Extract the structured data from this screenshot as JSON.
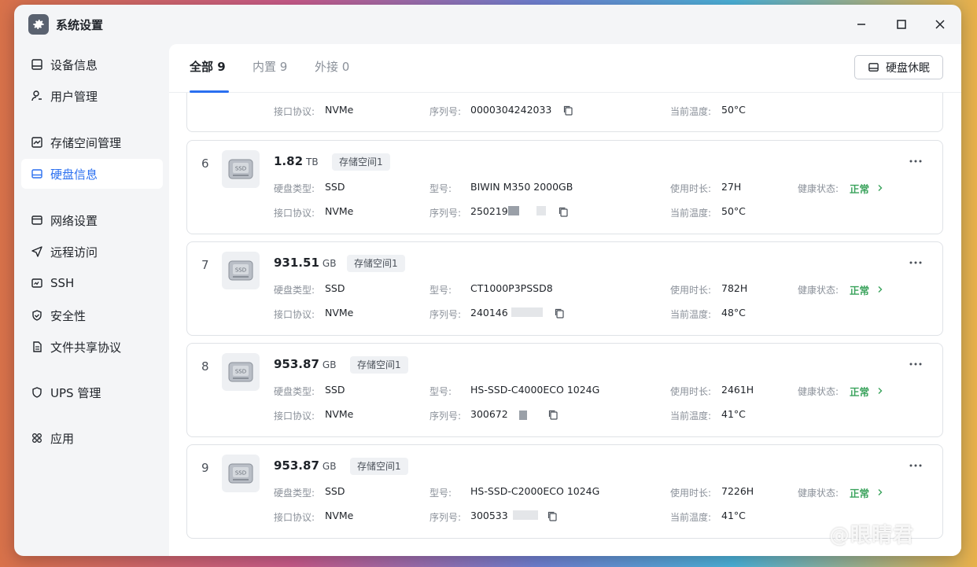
{
  "app": {
    "title": "系统设置"
  },
  "sidebar": {
    "items": [
      {
        "label": "设备信息",
        "icon": "device-icon"
      },
      {
        "label": "用户管理",
        "icon": "user-icon"
      },
      {
        "label": "存储空间管理",
        "icon": "storage-icon"
      },
      {
        "label": "硬盘信息",
        "icon": "disk-icon",
        "active": true
      },
      {
        "label": "网络设置",
        "icon": "network-icon"
      },
      {
        "label": "远程访问",
        "icon": "send-icon"
      },
      {
        "label": "SSH",
        "icon": "terminal-icon"
      },
      {
        "label": "安全性",
        "icon": "shield-check-icon"
      },
      {
        "label": "文件共享协议",
        "icon": "file-icon"
      },
      {
        "label": "UPS 管理",
        "icon": "shield-icon"
      },
      {
        "label": "应用",
        "icon": "apps-icon"
      }
    ]
  },
  "tabs": [
    {
      "label": "全部 9",
      "active": true
    },
    {
      "label": "内置 9"
    },
    {
      "label": "外接 0"
    }
  ],
  "toolbar": {
    "sleep_label": "硬盘休眠"
  },
  "labels": {
    "type": "硬盘类型:",
    "protocol": "接口协议:",
    "model": "型号:",
    "serial": "序列号:",
    "hours": "使用时长:",
    "temp": "当前温度:",
    "health": "健康状态:"
  },
  "partial_card": {
    "protocol": "NVMe",
    "serial": "0000304242033",
    "temp": "50°C"
  },
  "disks": [
    {
      "index": "6",
      "capacity": "1.82",
      "unit": "TB",
      "pool": "存储空间1",
      "type": "SSD",
      "protocol": "NVMe",
      "model": "BIWIN M350 2000GB",
      "serial": "250219",
      "hours": "27H",
      "temp": "50°C",
      "health": "正常"
    },
    {
      "index": "7",
      "capacity": "931.51",
      "unit": "GB",
      "pool": "存储空间1",
      "type": "SSD",
      "protocol": "NVMe",
      "model": "CT1000P3PSSD8",
      "serial": "240146",
      "hours": "782H",
      "temp": "48°C",
      "health": "正常"
    },
    {
      "index": "8",
      "capacity": "953.87",
      "unit": "GB",
      "pool": "存储空间1",
      "type": "SSD",
      "protocol": "NVMe",
      "model": "HS-SSD-C4000ECO 1024G",
      "serial": "300672",
      "hours": "2461H",
      "temp": "41°C",
      "health": "正常"
    },
    {
      "index": "9",
      "capacity": "953.87",
      "unit": "GB",
      "pool": "存储空间1",
      "type": "SSD",
      "protocol": "NVMe",
      "model": "HS-SSD-C2000ECO 1024G",
      "serial": "300533",
      "hours": "7226H",
      "temp": "41°C",
      "health": "正常"
    }
  ],
  "watermark": "@眼睛君",
  "colors": {
    "accent": "#2a6ff0",
    "ok": "#3aa35c"
  }
}
